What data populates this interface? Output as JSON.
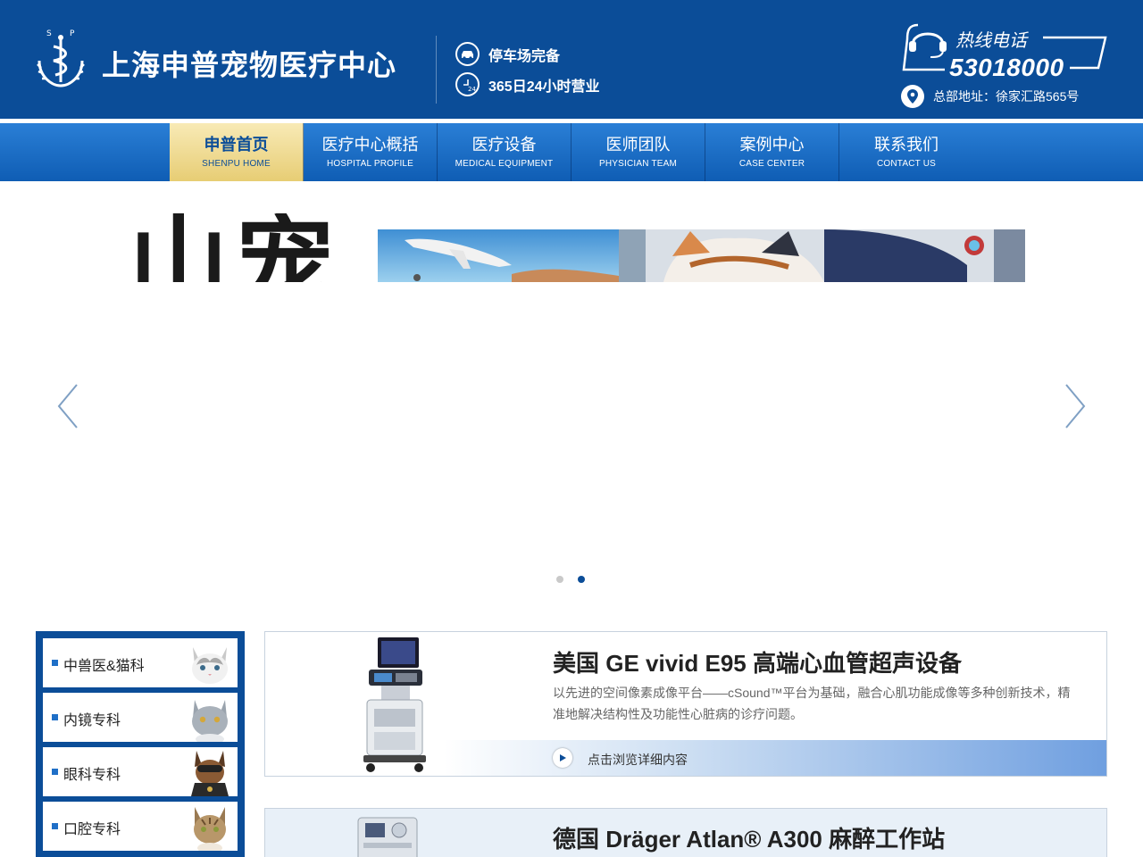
{
  "header": {
    "logo_caption": "S P",
    "title": "上海申普宠物医疗中心",
    "features": [
      {
        "icon": "car-icon",
        "label": "停车场完备"
      },
      {
        "icon": "clock-24-icon",
        "label": "365日24小时营业"
      }
    ],
    "hotline": {
      "label": "热线电话",
      "number": "53018000",
      "icon": "headset-icon"
    },
    "address": {
      "icon": "location-pin-icon",
      "text": "总部地址：徐家汇路565号"
    }
  },
  "nav": {
    "items": [
      {
        "cn": "申普首页",
        "en": "SHENPU HOME",
        "active": true
      },
      {
        "cn": "医疗中心概括",
        "en": "HOSPITAL PROFILE"
      },
      {
        "cn": "医疗设备",
        "en": "MEDICAL EQUIPMENT"
      },
      {
        "cn": "医师团队",
        "en": "PHYSICIAN TEAM"
      },
      {
        "cn": "案例中心",
        "en": "CASE CENTER"
      },
      {
        "cn": "联系我们",
        "en": "CONTACT US"
      }
    ]
  },
  "banner": {
    "headline_fragment": "山宠",
    "slide_count": 2,
    "active_slide": 2
  },
  "sidebar": {
    "items": [
      {
        "label": "中兽医&猫科",
        "pet": "kitten"
      },
      {
        "label": "内镜专科",
        "pet": "grey-cat"
      },
      {
        "label": "眼科专科",
        "pet": "dog-with-goggles"
      },
      {
        "label": "口腔专科",
        "pet": "tabby-cat"
      }
    ]
  },
  "equipment": [
    {
      "title": "美国 GE vivid E95 高端心血管超声设备",
      "description": "以先进的空间像素成像平台——cSound™平台为基础，融合心肌功能成像等多种创新技术，精准地解决结构性及功能性心脏病的诊疗问题。",
      "more_label": "点击浏览详细内容"
    },
    {
      "title": "德国 Dräger Atlan® A300 麻醉工作站"
    }
  ],
  "colors": {
    "brand_blue": "#0b4d98",
    "nav_active_gold": "#e7cd74",
    "nav_blue": "#1f6fc7"
  }
}
